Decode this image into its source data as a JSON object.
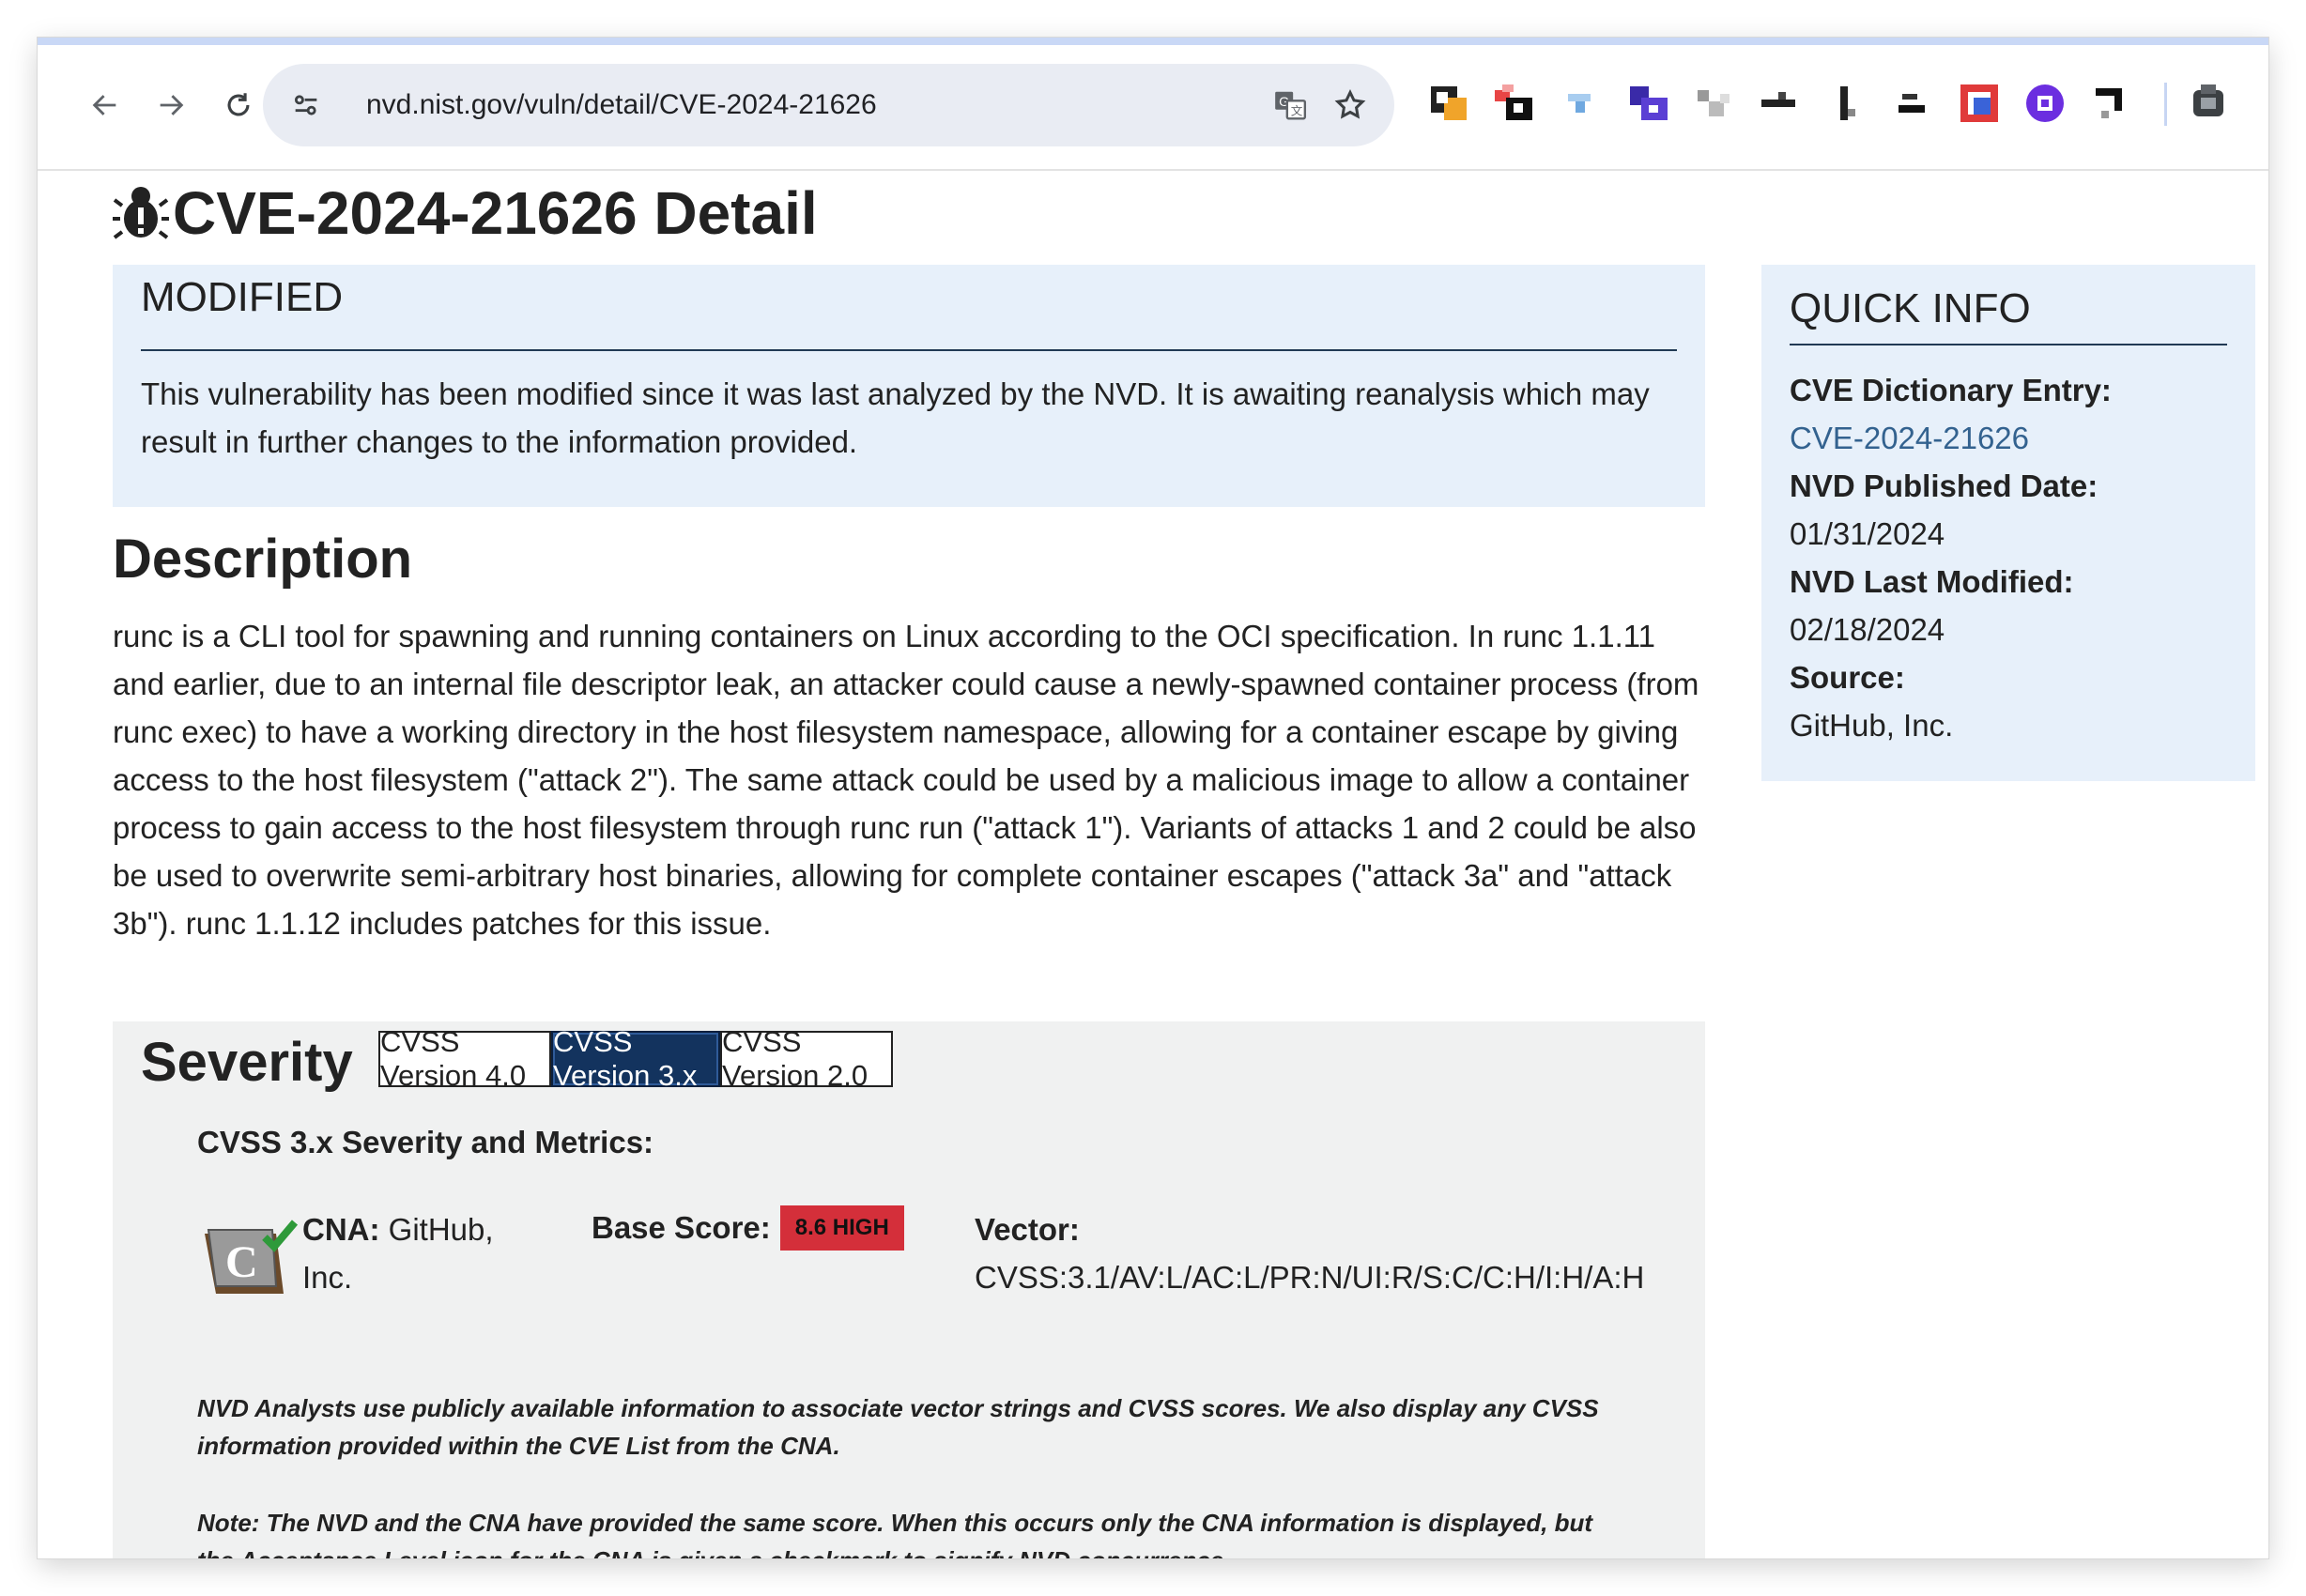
{
  "browser": {
    "url": "nvd.nist.gov/vuln/detail/CVE-2024-21626",
    "icons": [
      "back-arrow-icon",
      "forward-arrow-icon",
      "reload-icon",
      "site-settings-icon",
      "translate-icon",
      "bookmark-star-icon"
    ],
    "extensions": [
      "extension-1",
      "extension-2",
      "extension-3",
      "extension-4",
      "extension-5",
      "extension-6",
      "extension-7",
      "extension-8",
      "extension-9",
      "extension-10",
      "extension-11",
      "extension-12"
    ]
  },
  "page": {
    "title": "CVE-2024-21626 Detail"
  },
  "modified": {
    "title": "MODIFIED",
    "text": "This vulnerability has been modified since it was last analyzed by the NVD. It is awaiting reanalysis which may result in further changes to the information provided."
  },
  "description": {
    "heading": "Description",
    "text": "runc is a CLI tool for spawning and running containers on Linux according to the OCI specification. In runc 1.1.11 and earlier, due to an internal file descriptor leak, an attacker could cause a newly-spawned container process (from runc exec) to have a working directory in the host filesystem namespace, allowing for a container escape by giving access to the host filesystem (\"attack 2\"). The same attack could be used by a malicious image to allow a container process to gain access to the host filesystem through runc run (\"attack 1\"). Variants of attacks 1 and 2 could be also be used to overwrite semi-arbitrary host binaries, allowing for complete container escapes (\"attack 3a\" and \"attack 3b\"). runc 1.1.12 includes patches for this issue."
  },
  "quick_info": {
    "title": "QUICK INFO",
    "cve_label": "CVE Dictionary Entry:",
    "cve_value": "CVE-2024-21626",
    "published_label": "NVD Published Date:",
    "published_value": "01/31/2024",
    "modified_label": "NVD Last Modified:",
    "modified_value": "02/18/2024",
    "source_label": "Source:",
    "source_value": "GitHub, Inc."
  },
  "severity": {
    "heading": "Severity",
    "tabs": [
      "CVSS Version 4.0",
      "CVSS Version 3.x",
      "CVSS Version 2.0"
    ],
    "active_tab": "CVSS Version 3.x",
    "metrics_heading": "CVSS 3.x Severity and Metrics:",
    "cna_label": "CNA:",
    "cna_value": "GitHub, Inc.",
    "base_score_label": "Base Score:",
    "base_score_value": "8.6 HIGH",
    "vector_label": "Vector:",
    "vector_value": "CVSS:3.1/AV:L/AC:L/PR:N/UI:R/S:C/C:H/I:H/A:H",
    "note1": "NVD Analysts use publicly available information to associate vector strings and CVSS scores. We also display any CVSS information provided within the CVE List from the CNA.",
    "note2": "Note: The NVD and the CNA have provided the same score. When this occurs only the CNA information is displayed, but the Acceptance Level icon for the CNA is given a checkmark to signify NVD concurrence."
  },
  "colors": {
    "info_bg": "#e7f0fa",
    "severity_bg": "#f0f1f1",
    "active_tab": "#13335e",
    "high_badge": "#d42f3a",
    "link": "#33628f"
  }
}
